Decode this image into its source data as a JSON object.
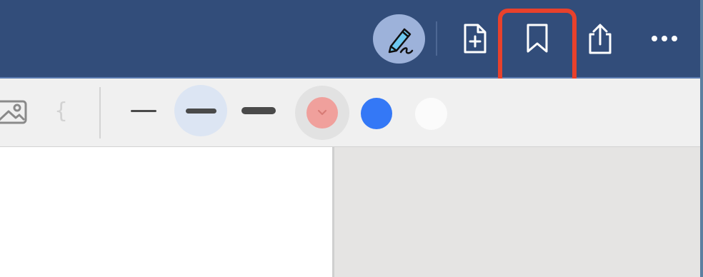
{
  "header": {
    "background": "#324d7a",
    "buttons": [
      {
        "name": "signature",
        "icon": "signature-pen-icon"
      },
      {
        "name": "add-page",
        "icon": "add-page-icon"
      },
      {
        "name": "bookmark",
        "icon": "bookmark-icon"
      },
      {
        "name": "share",
        "icon": "share-icon"
      },
      {
        "name": "more",
        "icon": "more-icon"
      }
    ],
    "highlighted": "bookmark",
    "highlight_color": "#e8412c"
  },
  "toolbar": {
    "tools": [
      {
        "name": "image",
        "icon": "image-icon"
      },
      {
        "name": "brace",
        "icon": "brace-icon"
      }
    ],
    "stroke_widths": [
      "thin",
      "medium",
      "thick"
    ],
    "selected_stroke": "medium",
    "colors": [
      "#f0a09c",
      "#3478f6",
      "#fbfbfb"
    ],
    "selected_color": "#f0a09c"
  },
  "canvas": {
    "page_color": "#ffffff",
    "background": "#e5e4e3"
  }
}
